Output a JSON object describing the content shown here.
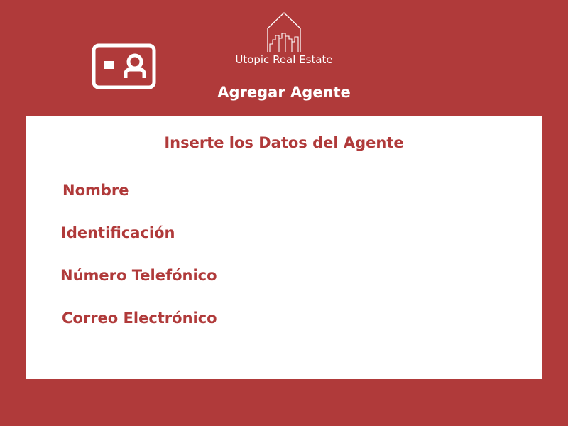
{
  "header": {
    "brand_name": "Utopic Real Estate",
    "page_title": "Agregar Agente",
    "agent_icon": "agent-id-card-icon",
    "logo_icon": "house-city-logo-icon"
  },
  "form": {
    "heading": "Inserte los Datos del Agente",
    "fields": [
      {
        "label": "Nombre"
      },
      {
        "label": "Identificación"
      },
      {
        "label": "Número Telefónico"
      },
      {
        "label": "Correo Electrónico"
      }
    ]
  },
  "colors": {
    "accent": "#b03a3a",
    "panel": "#ffffff",
    "text_on_accent": "#ffffff"
  }
}
